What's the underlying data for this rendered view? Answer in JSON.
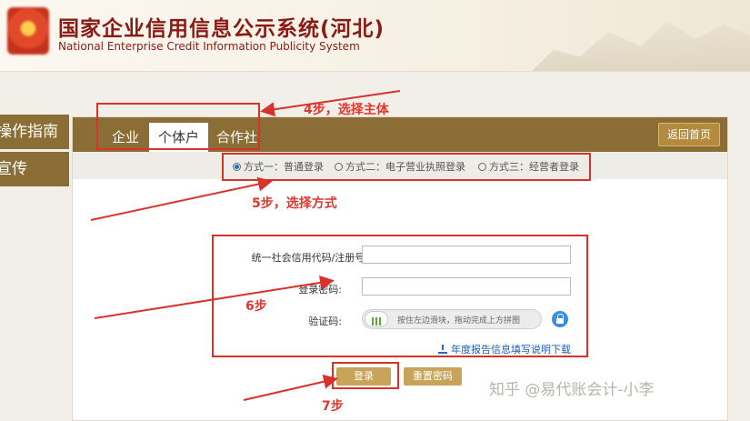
{
  "header": {
    "title_cn": "国家企业信用信息公示系统(河北)",
    "title_en": "National Enterprise Credit Information Publicity System"
  },
  "sidebar": {
    "items": [
      {
        "label": "操作指南"
      },
      {
        "label": "宣传"
      }
    ]
  },
  "tabs": [
    {
      "label": "企业"
    },
    {
      "label": "个体户",
      "active": true
    },
    {
      "label": "合作社"
    }
  ],
  "back_button": "返回首页",
  "login_methods": [
    {
      "label": "方式一：普通登录",
      "selected": true
    },
    {
      "label": "方式二：电子营业执照登录",
      "selected": false
    },
    {
      "label": "方式三：经营者登录",
      "selected": false
    }
  ],
  "form": {
    "credit_code_label": "统一社会信用代码/注册号:",
    "password_label": "登录密码:",
    "captcha_label": "验证码:",
    "slider_hint": "按住左边滑块，拖动完成上方拼图",
    "download_link": "年度报告信息填写说明下载",
    "login_button": "登录",
    "reset_button": "重置密码"
  },
  "annotations": {
    "step4": "4步，选择主体",
    "step5": "5步，选择方式",
    "step6": "6步",
    "step7": "7步"
  },
  "watermark": "知乎 @易代账会计-小李",
  "colors": {
    "brand_gold": "#8a6e35",
    "annotation_red": "#d9312b",
    "title_red": "#8a1a14"
  }
}
